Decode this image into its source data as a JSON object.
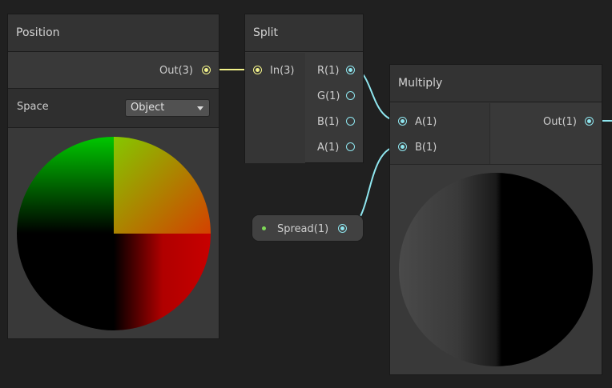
{
  "position_node": {
    "title": "Position",
    "output_label": "Out(3)",
    "space_label": "Space",
    "space_value": "Object"
  },
  "split_node": {
    "title": "Split",
    "input_label": "In(3)",
    "outputs": [
      "R(1)",
      "G(1)",
      "B(1)",
      "A(1)"
    ]
  },
  "multiply_node": {
    "title": "Multiply",
    "inputs": [
      "A(1)",
      "B(1)"
    ],
    "output_label": "Out(1)"
  },
  "property_node": {
    "label": "Spread(1)"
  },
  "colors": {
    "background": "#202020",
    "node_body": "#393939",
    "node_header": "#333333",
    "vector3_port": "#f2f28a",
    "vector1_port": "#8fe6ef"
  }
}
